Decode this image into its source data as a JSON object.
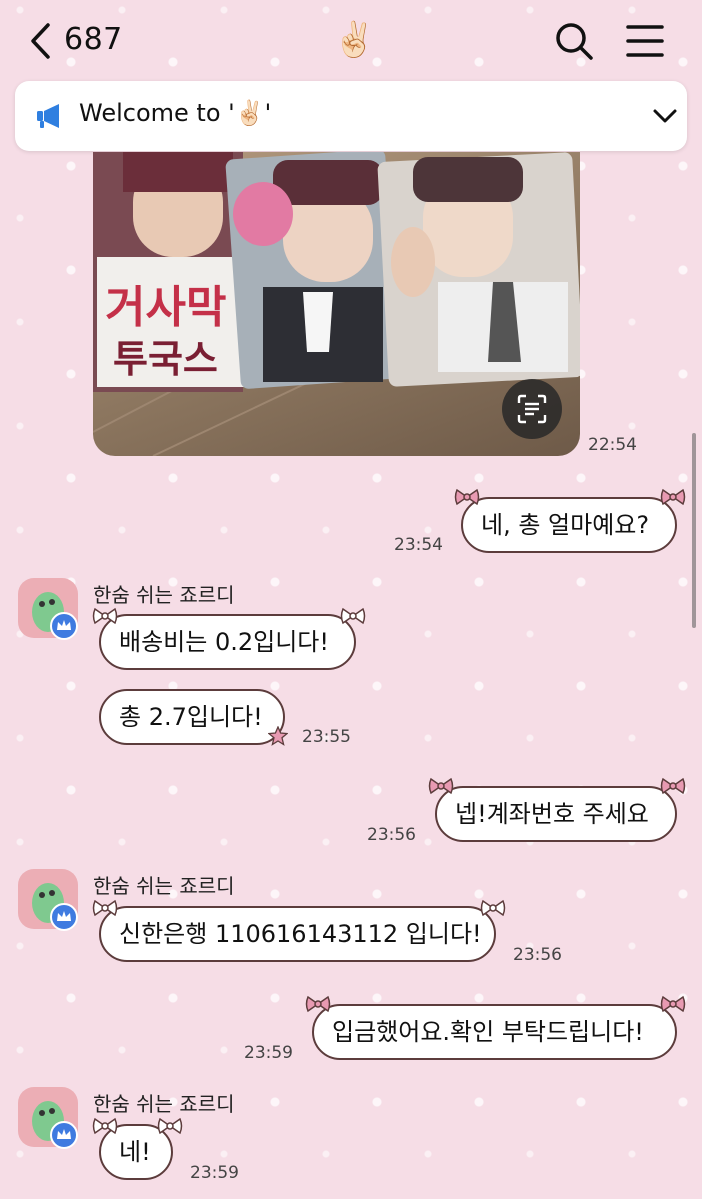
{
  "header": {
    "count": "687",
    "title": "✌🏻"
  },
  "notice": {
    "text": "Welcome to '✌🏻'"
  },
  "photo": {
    "time": "22:54"
  },
  "messages": [
    {
      "side": "right",
      "text": "네, 총 얼마예요?",
      "time": "23:54"
    },
    {
      "side": "left",
      "sender": "한숨 쉬는 죠르디",
      "text": "배송비는 0.2입니다!"
    },
    {
      "side": "left",
      "text": "총 2.7입니다!",
      "time": "23:55"
    },
    {
      "side": "right",
      "text": "넵!계좌번호 주세요",
      "time": "23:56"
    },
    {
      "side": "left",
      "sender": "한숨 쉬는 죠르디",
      "text": "신한은행 110616143112 입니다!",
      "time": "23:56"
    },
    {
      "side": "right",
      "text": "입금했어요.확인 부탁드립니다!",
      "time": "23:59"
    },
    {
      "side": "left",
      "sender": "한숨 쉬는 죠르디",
      "text": "네!",
      "time": "23:59"
    }
  ],
  "colors": {
    "background": "#f6dde6",
    "bubble_border": "#5c3c3c",
    "bow": "#e89ab2",
    "badge": "#3f7be0"
  },
  "icons": [
    "back-chevron-icon",
    "search-icon",
    "menu-icon",
    "megaphone-icon",
    "chevron-down-icon",
    "scan-text-icon",
    "crown-badge-icon",
    "ribbon-bow-icon"
  ]
}
